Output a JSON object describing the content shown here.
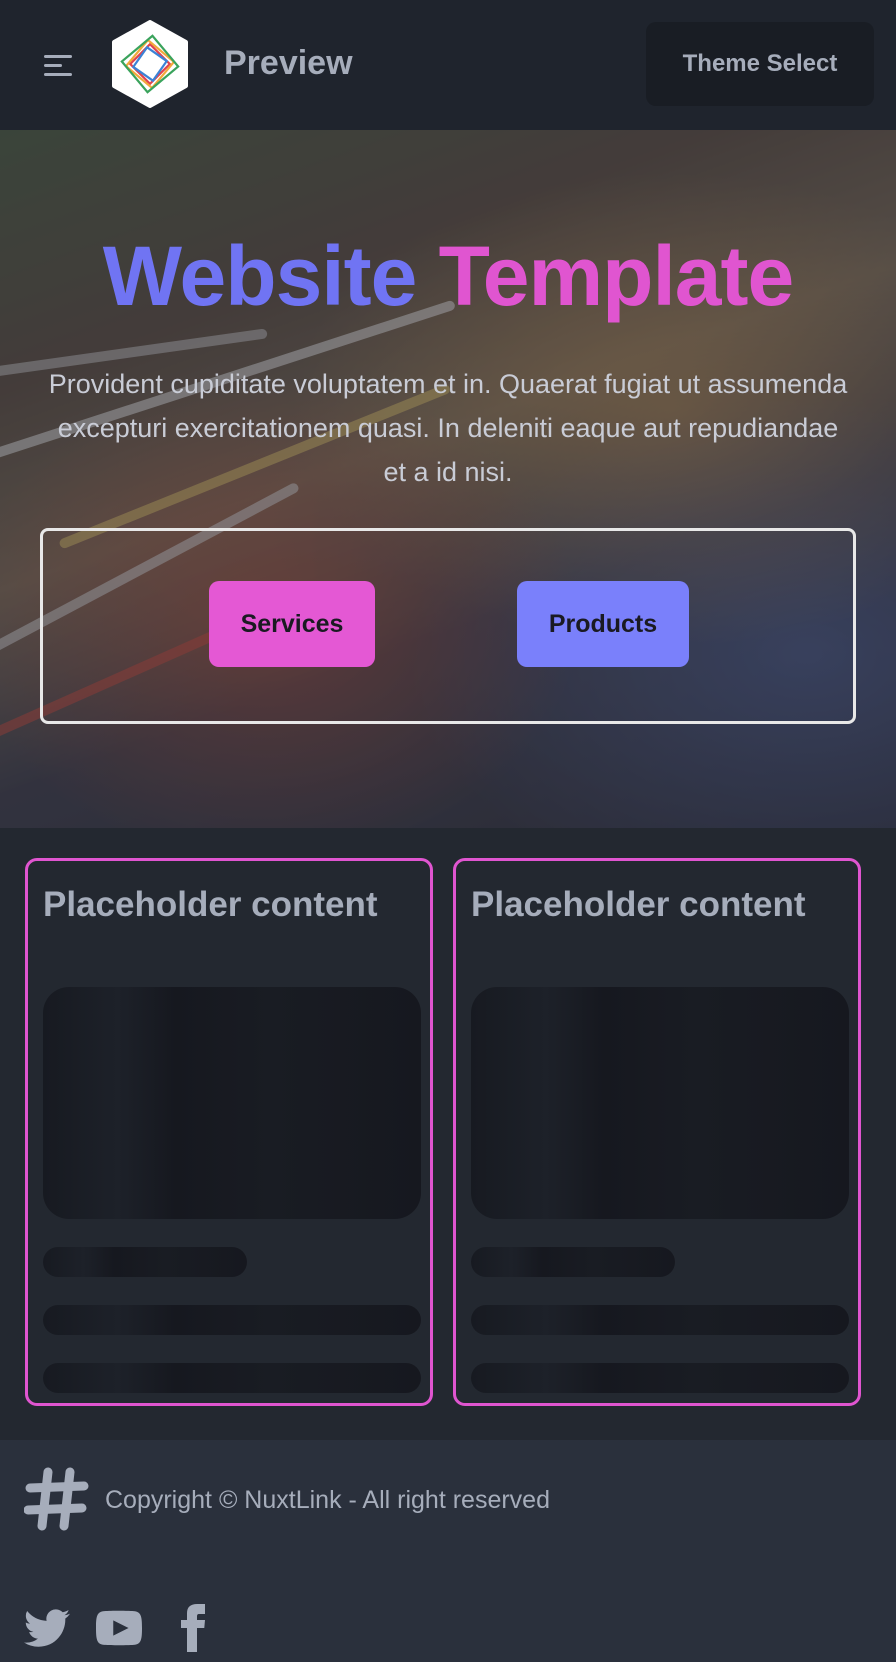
{
  "navbar": {
    "menu_icon": "hamburger-menu-icon",
    "logo_icon": "diamond-logo-icon",
    "brand": "Preview",
    "theme_select": "Theme Select"
  },
  "hero": {
    "title_part1": "Website",
    "title_part2": "Template",
    "description": "Provident cupiditate voluptatem et in. Quaerat fugiat ut assumenda excepturi exercitationem quasi. In deleniti eaque aut repudiandae et a id nisi.",
    "buttons": [
      {
        "label": "Services",
        "color": "#e458d4"
      },
      {
        "label": "Products",
        "color": "#7a80fb"
      }
    ]
  },
  "cards": [
    {
      "title": "Placeholder content"
    },
    {
      "title": "Placeholder content"
    }
  ],
  "footer": {
    "logo_icon": "hashtag-logo-icon",
    "copyright": "Copyright © NuxtLink - All right reserved",
    "social": [
      "twitter-icon",
      "youtube-icon",
      "facebook-icon"
    ]
  },
  "colors": {
    "accent_pink": "#e055d0",
    "accent_blue": "#7074f3",
    "nav_bg": "#1f242d",
    "body_bg": "#2a303c",
    "text": "#a6adbb"
  }
}
